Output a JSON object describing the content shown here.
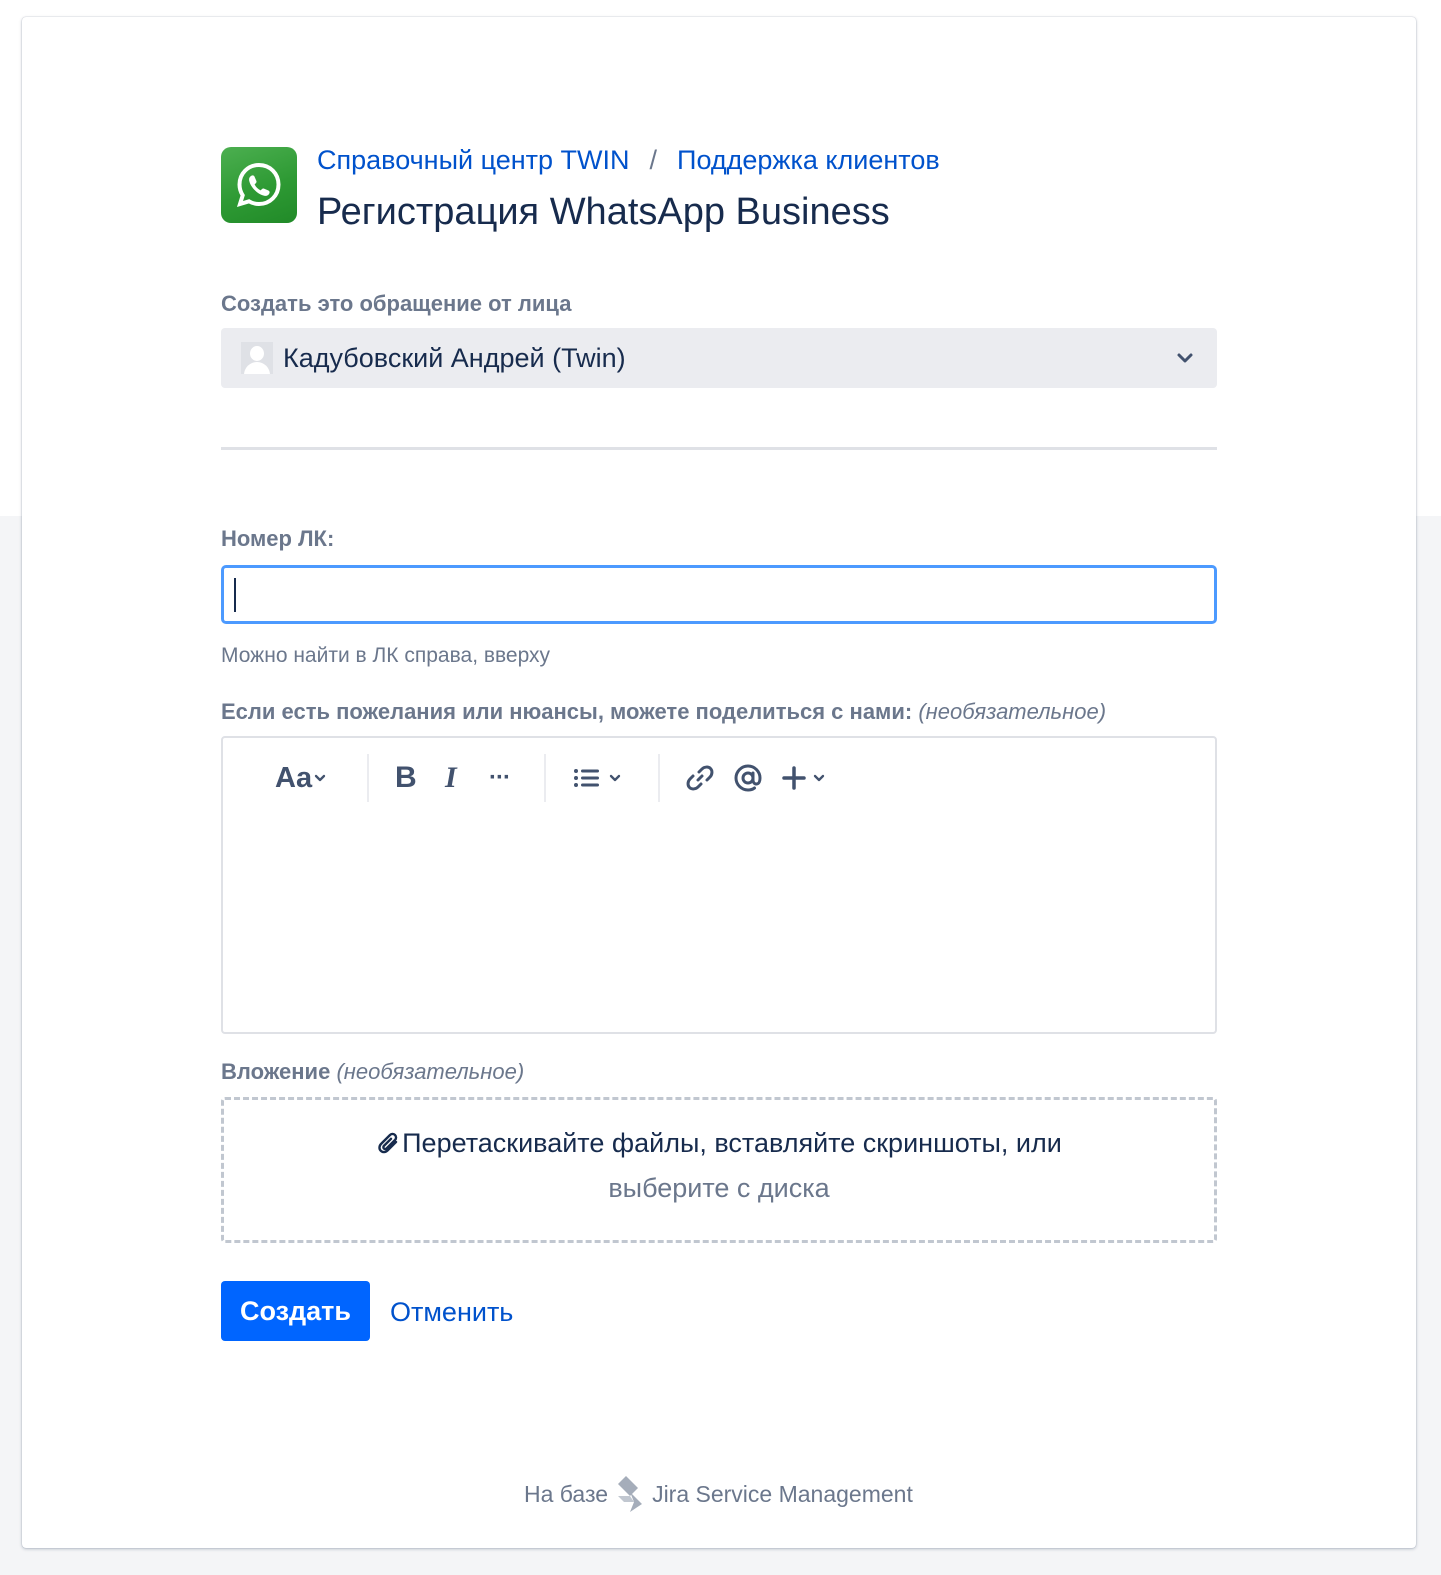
{
  "colors": {
    "link": "#0052cc",
    "primary": "#0065ff",
    "focus": "#4c9aff",
    "text": "#172b4d",
    "muted": "#6b778c"
  },
  "header": {
    "logo_icon": "whatsapp-icon",
    "breadcrumb": {
      "help_center": "Справочный центр TWIN",
      "separator": "/",
      "portal": "Поддержка клиентов"
    },
    "title": "Регистрация WhatsApp Business"
  },
  "raise_on_behalf": {
    "label": "Создать это обращение от лица",
    "value": "Кадубовский Андрей (Twin)"
  },
  "account_number": {
    "label": "Номер ЛК:",
    "value": "",
    "helper": "Можно найти в ЛК справа, вверху"
  },
  "wishes": {
    "label": "Если есть пожелания или нюансы, можете поделиться с нами:",
    "optional": "(необязательное)",
    "toolbar": {
      "text_style": "Aa",
      "bold": "B",
      "italic": "I",
      "more": "···"
    }
  },
  "attachment": {
    "label": "Вложение",
    "optional": "(необязательное)",
    "drop_text": "Перетаскивайте файлы, вставляйте скриншоты, или",
    "browse_text": "выберите с диска"
  },
  "actions": {
    "create": "Создать",
    "cancel": "Отменить"
  },
  "footer": {
    "powered_by": "На базе",
    "product": "Jira Service Management"
  }
}
